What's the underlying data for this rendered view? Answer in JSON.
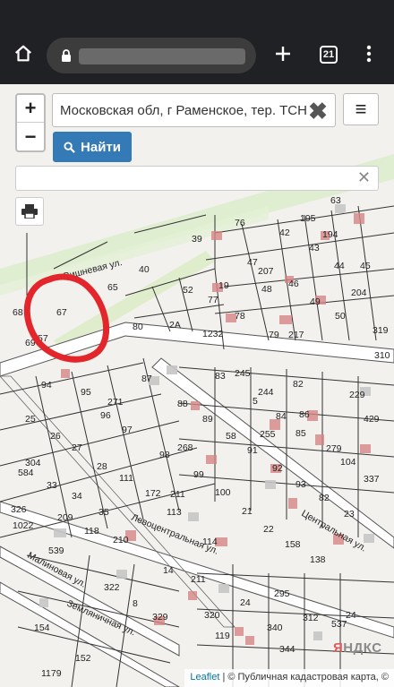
{
  "browser": {
    "home_icon": "home-icon",
    "lock_icon": "lock-icon",
    "new_tab_icon": "plus-icon",
    "tab_count": "21",
    "overflow_icon": "more-vert-icon"
  },
  "map_controls": {
    "zoom_in": "+",
    "zoom_out": "−",
    "search_value": "Московская обл, г Раменское, тер. ТСН",
    "clear_icon": "✖",
    "menu_icon": "≡",
    "find_label": "Найти",
    "second_clear": "✕"
  },
  "attribution": {
    "leaflet": "Leaflet",
    "separator": " | © Публичная кадастровая карта, ©",
    "yandex_red": "Я",
    "yandex_rest": "НДКС"
  },
  "streets": [
    {
      "name": "Вишневая ул."
    },
    {
      "name": "Левоцентральная ул."
    },
    {
      "name": "Центральная ул."
    },
    {
      "name": "Малиновая ул."
    },
    {
      "name": "Земляничная ул."
    }
  ],
  "plots": [
    "63",
    "76",
    "195",
    "194",
    "39",
    "42",
    "43",
    "44",
    "40",
    "47",
    "207",
    "45",
    "204",
    "65",
    "52",
    "46",
    "49",
    "50",
    "68",
    "67",
    "19",
    "77",
    "48",
    "78",
    "80",
    "2",
    "2А",
    "1232",
    "79",
    "217",
    "319",
    "69",
    "57",
    "310",
    "87",
    "83",
    "245",
    "244",
    "82",
    "94",
    "95",
    "271",
    "88",
    "229",
    "26",
    "25",
    "96",
    "268",
    "5",
    "84",
    "86",
    "97",
    "89",
    "58",
    "255",
    "85",
    "429",
    "27",
    "98",
    "91",
    "92",
    "104",
    "304",
    "28",
    "279",
    "584",
    "337",
    "111",
    "99",
    "93",
    "34",
    "33",
    "172",
    "100",
    "326",
    "211",
    "82",
    "35",
    "118",
    "209",
    "113",
    "21",
    "158",
    "22",
    "1022",
    "210",
    "23",
    "539",
    "114",
    "138",
    "14",
    "322",
    "211",
    "24",
    "340",
    "295",
    "312",
    "8",
    "329",
    "320",
    "24",
    "344",
    "154",
    "119",
    "152",
    "1179",
    "537"
  ],
  "colors": {
    "circle": "#e3262b",
    "find_button": "#337ab7",
    "map_bg": "#f3f1ee"
  }
}
